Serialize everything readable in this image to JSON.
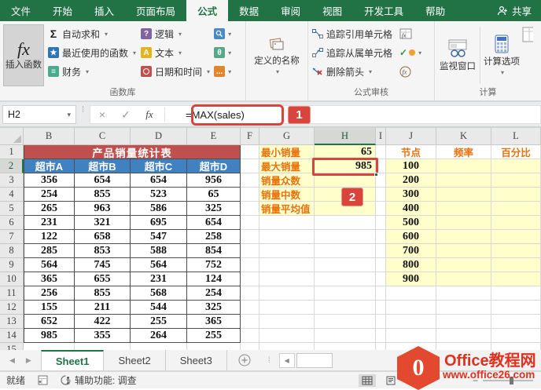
{
  "tab_bar": {
    "tabs": [
      "文件",
      "开始",
      "插入",
      "页面布局",
      "公式",
      "数据",
      "审阅",
      "视图",
      "开发工具",
      "帮助"
    ],
    "active": "公式",
    "share_label": "共享"
  },
  "ribbon": {
    "insert_function": {
      "glyph": "fx",
      "label": "插入函数"
    },
    "function_library": {
      "label": "函数库",
      "col1": [
        {
          "icon": "autosum-icon",
          "glyph": "Σ",
          "label": "自动求和"
        },
        {
          "icon": "recent-functions-icon",
          "glyph": "★",
          "label": "最近使用的函数"
        },
        {
          "icon": "financial-icon",
          "glyph": "≡",
          "label": "财务"
        }
      ],
      "col2": [
        {
          "icon": "logical-icon",
          "glyph": "?",
          "label": "逻辑"
        },
        {
          "icon": "text-icon",
          "glyph": "A",
          "label": "文本"
        },
        {
          "icon": "datetime-icon",
          "glyph": "",
          "label": "日期和时间"
        }
      ],
      "col3": [
        {
          "icon": "lookup-reference-icon"
        },
        {
          "icon": "math-trig-icon",
          "glyph": "θ"
        },
        {
          "icon": "more-functions-icon",
          "glyph": "..."
        }
      ]
    },
    "defined_names": {
      "label": "定义的名称"
    },
    "formula_auditing": {
      "label": "公式审核",
      "items": [
        "追踪引用单元格",
        "追踪从属单元格",
        "删除箭头"
      ]
    },
    "calculation": {
      "label": "计算",
      "watch_window": "监视窗口",
      "calc_options": "计算选项"
    }
  },
  "formula_bar": {
    "name_box": "H2",
    "formula": "=MAX(sales)"
  },
  "annotations": {
    "badge_1": "1",
    "badge_2": "2"
  },
  "grid": {
    "columns": [
      "B",
      "C",
      "D",
      "E",
      "F",
      "G",
      "H",
      "I",
      "J",
      "K",
      "L"
    ],
    "selected_column": "H",
    "selected_row": 2,
    "title": "产品销量统计表",
    "store_headers": [
      "超市A",
      "超市B",
      "超市C",
      "超市D"
    ],
    "sales_rows": [
      [
        356,
        654,
        654,
        956
      ],
      [
        254,
        855,
        523,
        65
      ],
      [
        265,
        963,
        586,
        325
      ],
      [
        231,
        321,
        695,
        654
      ],
      [
        122,
        658,
        547,
        258
      ],
      [
        285,
        853,
        588,
        854
      ],
      [
        564,
        745,
        564,
        752
      ],
      [
        365,
        655,
        231,
        124
      ],
      [
        256,
        855,
        568,
        254
      ],
      [
        155,
        211,
        544,
        325
      ],
      [
        652,
        422,
        255,
        365
      ],
      [
        985,
        355,
        264,
        255
      ]
    ],
    "stat_labels": [
      "最小销量",
      "最大销量",
      "销量众数",
      "销量中数",
      "销量平均值"
    ],
    "min_sales": "65",
    "max_sales": "985",
    "bin_headers": [
      "节点",
      "频率",
      "百分比"
    ],
    "bins": [
      100,
      200,
      300,
      400,
      500,
      600,
      700,
      800,
      900
    ]
  },
  "sheet_bar": {
    "sheets": [
      "Sheet1",
      "Sheet2",
      "Sheet3"
    ],
    "active": "Sheet1"
  },
  "status_bar": {
    "ready": "就绪",
    "accessibility": "辅助功能: 调查"
  },
  "watermark": {
    "logo_glyph": "0",
    "title": "Office教程网",
    "url": "www.office26.com"
  },
  "colors": {
    "excel_green": "#217346",
    "annotation_red": "#d8453c",
    "table_red": "#c0504d",
    "table_blue": "#3f81c1",
    "cell_yellow": "#ffffcc",
    "accent_orange": "#e8720c"
  }
}
